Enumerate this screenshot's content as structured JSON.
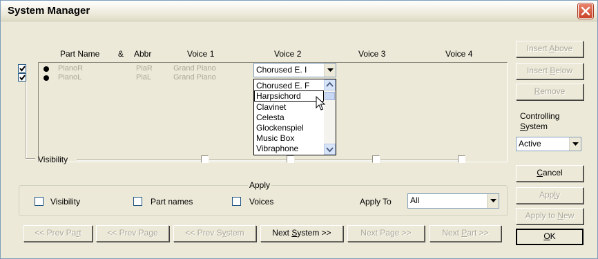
{
  "window": {
    "title": "System Manager"
  },
  "columns": {
    "part_name": "Part Name",
    "amp": "&",
    "abbr": "Abbr",
    "voice1": "Voice 1",
    "voice2": "Voice 2",
    "voice3": "Voice 3",
    "voice4": "Voice 4"
  },
  "parts": [
    {
      "name": "PianoR",
      "abbr": "PiaR",
      "voice1": "Grand Piano",
      "checked": true
    },
    {
      "name": "PianoL",
      "abbr": "PiaL",
      "voice1": "Grand Piano",
      "checked": true
    }
  ],
  "voice2_combo": {
    "value": "Chorused E. I"
  },
  "voice2_list": {
    "options": [
      "Chorused E. F",
      "Harpsichord",
      "Clavinet",
      "Celesta",
      "Glockenspiel",
      "Music Box",
      "Vibraphone"
    ],
    "selected": "Harpsichord"
  },
  "visibility_label": "Visibility",
  "apply_group": {
    "title": "Apply",
    "visibility": "Visibility",
    "part_names": "Part names",
    "voices": "Voices",
    "apply_to_label": "Apply To",
    "apply_to_value": "All"
  },
  "right_panel": {
    "insert_above": {
      "pre": "Insert ",
      "u": "A",
      "post": "bove"
    },
    "insert_below": {
      "pre": "Insert ",
      "u": "B",
      "post": "elow"
    },
    "remove": {
      "pre": "",
      "u": "R",
      "post": "emove"
    },
    "controlling_label_1": "Controlling",
    "controlling_label_2_u": "S",
    "controlling_label_2_post": "ystem",
    "controlling_value": "Active",
    "cancel": {
      "pre": "",
      "u": "C",
      "post": "ancel"
    },
    "apply": {
      "pre": "App",
      "u": "l",
      "post": "y"
    },
    "apply_to_new": {
      "pre": "Apply to ",
      "u": "N",
      "post": "ew"
    },
    "ok": {
      "pre": "",
      "u": "O",
      "post": "K"
    }
  },
  "nav": {
    "prev_part": {
      "pre": "<< Prev Pa",
      "u": "r",
      "post": "t"
    },
    "prev_page": {
      "pre": "<< Prev Pa",
      "u": "g",
      "post": "e"
    },
    "prev_system": {
      "pre": "<< Prev S",
      "u": "y",
      "post": "stem"
    },
    "next_system": {
      "pre": "Next ",
      "u": "S",
      "post": "ystem >>"
    },
    "next_page": {
      "pre": "Next Page >>",
      "u": "",
      "post": ""
    },
    "next_part": {
      "pre": "Next ",
      "u": "P",
      "post": "art >>"
    }
  },
  "colors": {
    "face": "#ece9d8",
    "disabled_text": "#aca899",
    "title_close": "#c9452a"
  },
  "icons": [
    "close-icon",
    "checkmark-icon",
    "bullet-icon",
    "dropdown-arrow-icon",
    "scroll-up-icon",
    "scroll-down-icon",
    "mouse-cursor-icon"
  ]
}
